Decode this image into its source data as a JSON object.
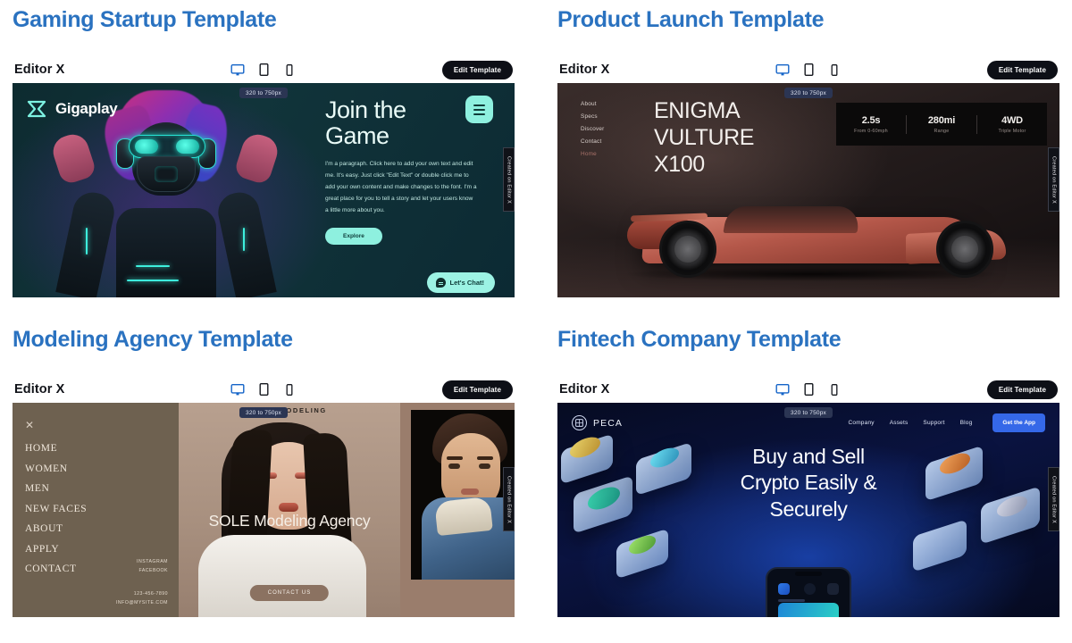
{
  "editor": {
    "brand": "Editor X",
    "edit_button": "Edit Template",
    "breakpoint_badge": "320 to 750px",
    "created_tab": "Created on Editor X",
    "devices": [
      {
        "name": "desktop",
        "active": true
      },
      {
        "name": "tablet",
        "active": false
      },
      {
        "name": "mobile",
        "active": false
      }
    ]
  },
  "templates": [
    {
      "title": "Gaming Startup Template",
      "site": {
        "logo": "Gigaplay",
        "heading_line1": "Join the",
        "heading_line2": "Game",
        "paragraph": "I'm a paragraph. Click here to add your own text and edit me. It's easy. Just click \"Edit Text\" or double click me to add your own content and make changes to the font. I'm a great place for you to tell a story and let your users know a little more about you.",
        "cta": "Explore",
        "chat": "Let's Chat!"
      }
    },
    {
      "title": "Product Launch Template",
      "site": {
        "nav": [
          "About",
          "Specs",
          "Discover",
          "Contact",
          "Home"
        ],
        "nav_active": "Home",
        "heading_line1": "ENIGMA",
        "heading_line2": "VULTURE",
        "heading_line3": "X100",
        "stats": [
          {
            "value": "2.5s",
            "label": "From 0-60mph"
          },
          {
            "value": "280mi",
            "label": "Range"
          },
          {
            "value": "4WD",
            "label": "Triple Motor"
          }
        ]
      }
    },
    {
      "title": "Modeling Agency Template",
      "site": {
        "close": "✕",
        "menu": [
          "HOME",
          "WOMEN",
          "MEN",
          "NEW FACES",
          "ABOUT",
          "APPLY",
          "CONTACT"
        ],
        "social": [
          "INSTAGRAM",
          "FACEBOOK"
        ],
        "contact": [
          "123-456-7890",
          "INFO@MYSITE.COM"
        ],
        "topbar": "SOLE MODELING",
        "heading": "SOLE Modeling Agency",
        "cta": "CONTACT US"
      }
    },
    {
      "title": "Fintech Company Template",
      "site": {
        "logo": "PECA",
        "nav": [
          "Company",
          "Assets",
          "Support",
          "Blog"
        ],
        "cta": "Get the App",
        "heading_line1": "Buy and Sell",
        "heading_line2": "Crypto Easily &",
        "heading_line3": "Securely"
      }
    }
  ],
  "colors": {
    "title_blue": "#2a72c0",
    "accent_mint": "#8ef0df",
    "fintech_blue": "#3568e8",
    "device_active": "#1464c8"
  }
}
